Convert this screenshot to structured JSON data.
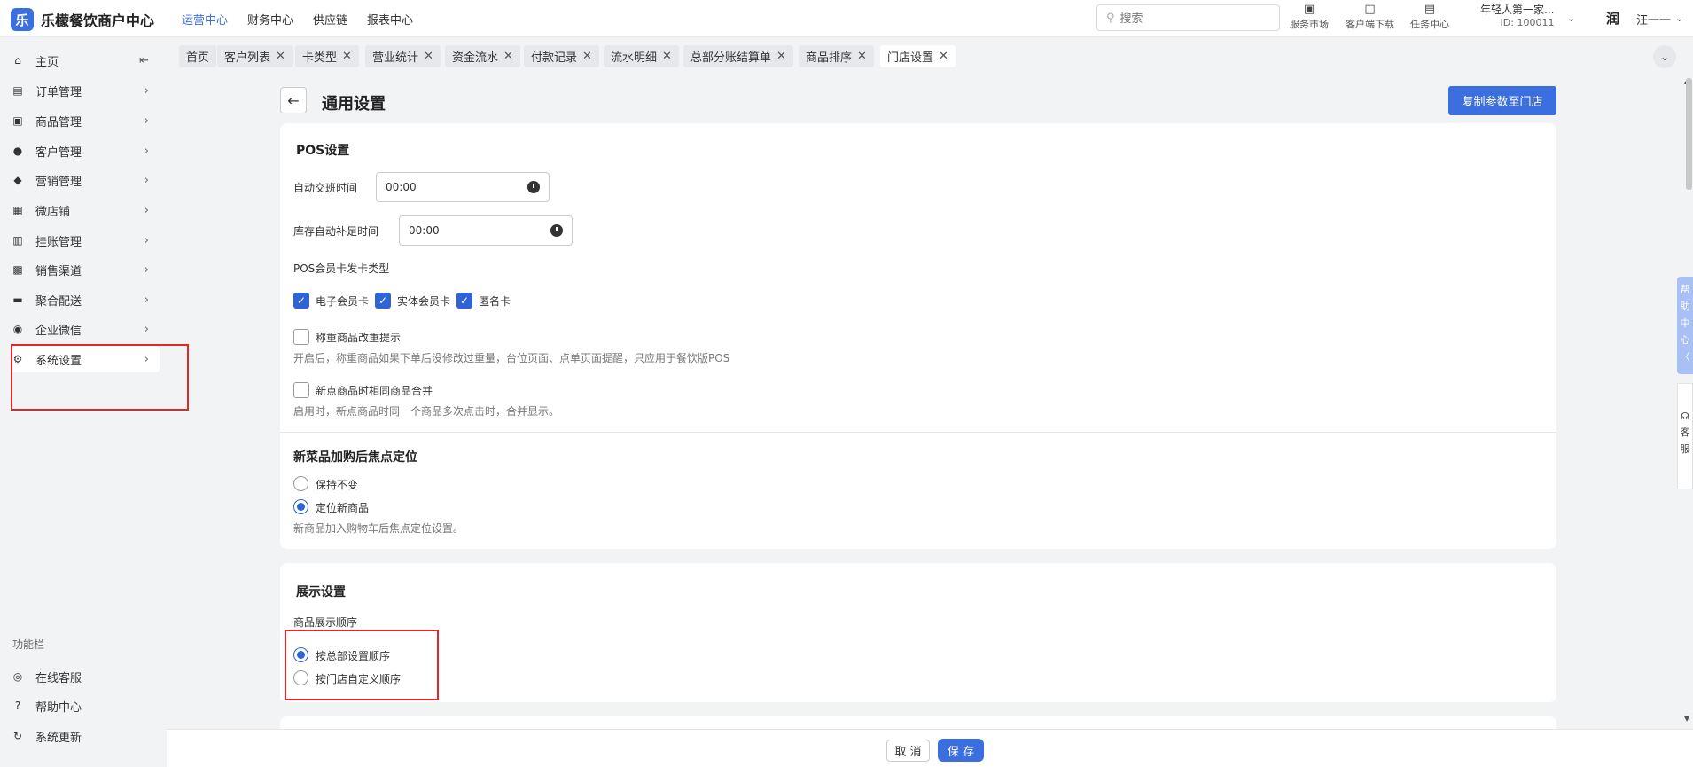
{
  "app": {
    "logo_char": "乐",
    "name": "乐檬餐饮商户中心"
  },
  "topnav": [
    "运营中心",
    "财务中心",
    "供应链",
    "报表中心"
  ],
  "search": {
    "placeholder": "搜索"
  },
  "tools": [
    {
      "label": "服务市场",
      "icon": "store-icon"
    },
    {
      "label": "客户端下载",
      "icon": "download-folder-icon"
    },
    {
      "label": "任务中心",
      "icon": "clipboard-icon"
    }
  ],
  "store": {
    "name": "年轻人第一家...",
    "id": "ID: 100011"
  },
  "user": {
    "avatar_text": "润",
    "name": "汪一一"
  },
  "sidebar": {
    "items": [
      {
        "label": "主页",
        "icon": "home-icon",
        "glyph": "⌂"
      },
      {
        "label": "订单管理",
        "icon": "order-icon",
        "glyph": "▤"
      },
      {
        "label": "商品管理",
        "icon": "goods-icon",
        "glyph": "▣"
      },
      {
        "label": "客户管理",
        "icon": "user-icon",
        "glyph": "●"
      },
      {
        "label": "营销管理",
        "icon": "tag-icon",
        "glyph": "◆"
      },
      {
        "label": "微店铺",
        "icon": "shop-icon",
        "glyph": "▦"
      },
      {
        "label": "挂账管理",
        "icon": "ledger-icon",
        "glyph": "▥"
      },
      {
        "label": "销售渠道",
        "icon": "bank-icon",
        "glyph": "▩"
      },
      {
        "label": "聚合配送",
        "icon": "truck-icon",
        "glyph": "▬"
      },
      {
        "label": "企业微信",
        "icon": "wechat-icon",
        "glyph": "◉"
      },
      {
        "label": "系统设置",
        "icon": "gear-icon",
        "glyph": "⚙"
      }
    ],
    "func_title": "功能栏",
    "func_items": [
      {
        "label": "在线客服",
        "icon": "eye-icon",
        "glyph": "◎"
      },
      {
        "label": "帮助中心",
        "icon": "help-icon",
        "glyph": "?"
      },
      {
        "label": "系统更新",
        "icon": "refresh-icon",
        "glyph": "↻"
      }
    ]
  },
  "tabs": [
    "首页",
    "客户列表",
    "卡类型",
    "营业统计",
    "资金流水",
    "付款记录",
    "流水明细",
    "总部分账结算单",
    "商品排序",
    "门店设置"
  ],
  "page": {
    "title": "通用设置",
    "copy_button": "复制参数至门店"
  },
  "pos": {
    "title": "POS设置",
    "auto_shift_label": "自动交班时间",
    "auto_shift_value": "00:00",
    "stock_refill_label": "库存自动补足时间",
    "stock_refill_value": "00:00",
    "card_type_label": "POS会员卡发卡类型",
    "card_types": [
      {
        "label": "电子会员卡",
        "checked": true
      },
      {
        "label": "实体会员卡",
        "checked": true
      },
      {
        "label": "匿名卡",
        "checked": true
      }
    ],
    "weigh_label": "称重商品改重提示",
    "weigh_hint": "开启后，称重商品如果下单后没修改过重量，台位页面、点单页面提醒，只应用于餐饮版POS",
    "merge_label": "新点商品时相同商品合并",
    "merge_hint": "启用时，新点商品时同一个商品多次点击时，合并显示。"
  },
  "focus": {
    "title": "新菜品加购后焦点定位",
    "options": [
      {
        "label": "保持不变",
        "selected": false
      },
      {
        "label": "定位新商品",
        "selected": true
      }
    ],
    "hint": "新商品加入购物车后焦点定位设置。"
  },
  "display": {
    "title": "展示设置",
    "order_label": "商品展示顺序",
    "options": [
      {
        "label": "按总部设置顺序",
        "selected": true
      },
      {
        "label": "按门店自定义顺序",
        "selected": false
      }
    ]
  },
  "footer": {
    "cancel": "取 消",
    "save": "保 存"
  },
  "floats": {
    "help": [
      "帮",
      "助",
      "中",
      "心",
      "〈"
    ],
    "cs": [
      "客",
      "服"
    ]
  },
  "colors": {
    "accent": "#3b6fe0",
    "highlight_box": "#e32626"
  }
}
